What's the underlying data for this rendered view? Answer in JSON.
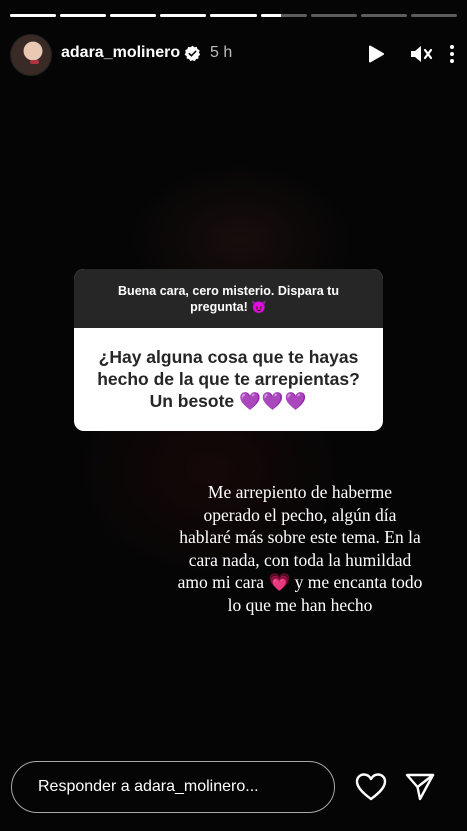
{
  "progress": {
    "segments": [
      1,
      1,
      1,
      1,
      1,
      0.45,
      0,
      0,
      0
    ]
  },
  "header": {
    "username": "adara_molinero",
    "time": "5 h",
    "icons": [
      "avatar",
      "verified-badge-icon",
      "play-icon",
      "mute-icon",
      "more-icon"
    ]
  },
  "sticker": {
    "prompt": "Buena cara, cero misterio. Dispara tu pregunta! 😈",
    "question": "¿Hay alguna cosa que te hayas hecho de la que te arrepientas? Un  besote",
    "hearts": "💜💜💜"
  },
  "answer": {
    "lines": [
      "Me arrepiento de haberme",
      "operado el pecho, algún día",
      "hablaré más sobre este tema. En la",
      "cara nada, con toda la humildad",
      "amo mi cara",
      "y me encanta todo",
      "lo que me han hecho"
    ],
    "heart": "💗"
  },
  "footer": {
    "reply_placeholder": "Responder a adara_molinero..."
  },
  "colors": {
    "background": "#000000",
    "sticker_header": "#262626",
    "sticker_body": "#ffffff",
    "heart_purple": "#9b30d9",
    "heart_pink": "#ff4fb8"
  }
}
